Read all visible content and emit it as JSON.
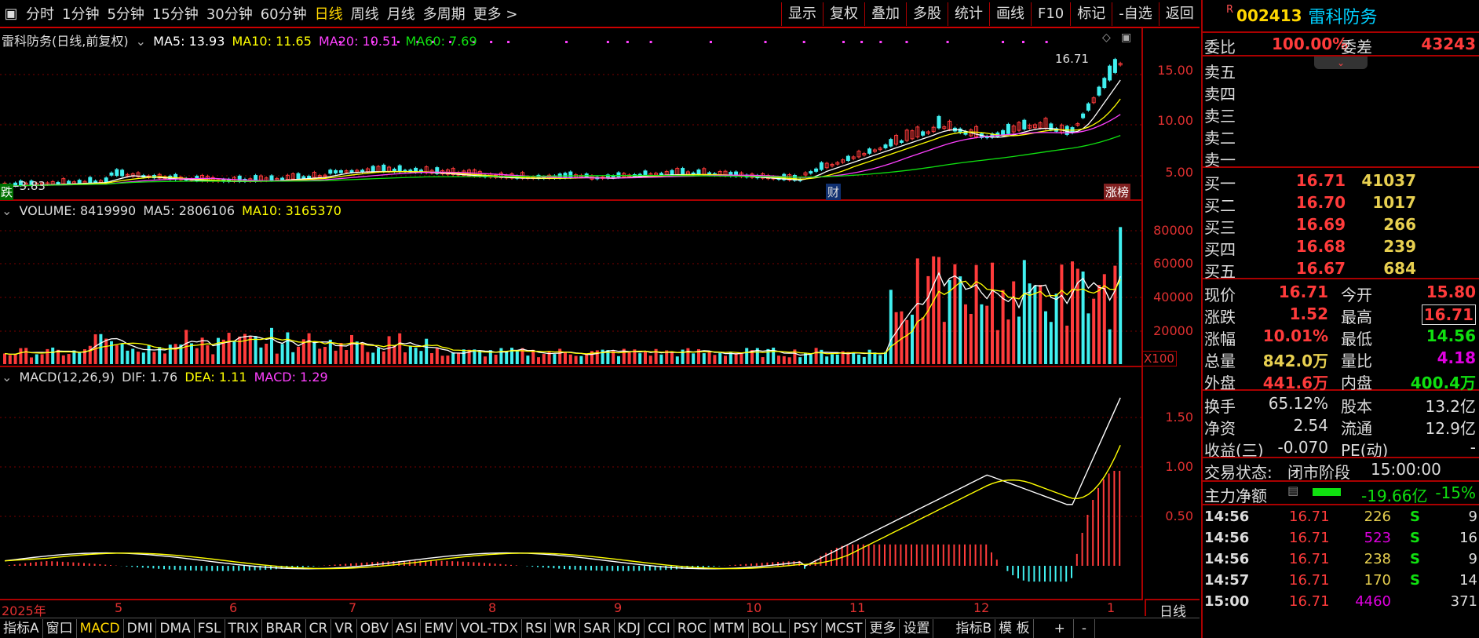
{
  "period_bar": {
    "items": [
      "分时",
      "1分钟",
      "5分钟",
      "15分钟",
      "30分钟",
      "60分钟",
      "日线",
      "周线",
      "月线",
      "多周期",
      "更多 >"
    ],
    "active_index": 6
  },
  "tool_bar": [
    "显示",
    "复权",
    "叠加",
    "多股",
    "统计",
    "画线",
    "F10",
    "标记",
    "-自选",
    "返回"
  ],
  "kline": {
    "title": "雷科防务(日线,前复权)",
    "ma5": "MA5: 13.93",
    "ma10": "MA10: 11.65",
    "ma20": "MA20: 10.51",
    "ma60": "MA60: 7.69",
    "high_marker": "16.71",
    "low_marker": "3.83",
    "y_ticks": [
      "15.00",
      "10.00",
      "5.00"
    ],
    "tag_fall": "跌",
    "tag_cai": "财",
    "tag_zhangbang": "涨榜"
  },
  "volume": {
    "title": "VOLUME: 8419990",
    "ma5": "MA5: 2806106",
    "ma10": "MA10: 3165370",
    "y_ticks": [
      "80000",
      "60000",
      "40000",
      "20000"
    ],
    "unit": "X100"
  },
  "macd": {
    "title": "MACD(12,26,9)",
    "dif": "DIF: 1.76",
    "dea": "DEA: 1.11",
    "macd": "MACD: 1.29",
    "y_ticks": [
      "1.50",
      "1.00",
      "0.50"
    ]
  },
  "date_axis": [
    "2025年",
    "5",
    "6",
    "7",
    "8",
    "9",
    "10",
    "11",
    "12",
    "1"
  ],
  "period_label": "日线",
  "indicator_tabs": [
    "指标A",
    "窗口",
    "MACD",
    "DMI",
    "DMA",
    "FSL",
    "TRIX",
    "BRAR",
    "CR",
    "VR",
    "OBV",
    "ASI",
    "EMV",
    "VOL-TDX",
    "RSI",
    "WR",
    "SAR",
    "KDJ",
    "CCI",
    "ROC",
    "MTM",
    "BOLL",
    "PSY",
    "MCST",
    "更多",
    "设置",
    "指标B",
    "模 板",
    "+",
    "-"
  ],
  "active_indicator": "MACD",
  "quote": {
    "r_mark": "R",
    "code": "002413",
    "name": "雷科防务",
    "weibi_label": "委比",
    "weibi": "100.00%",
    "weicha_label": "委差",
    "weicha": "43243",
    "sell": [
      {
        "label": "卖五",
        "price": "",
        "vol": ""
      },
      {
        "label": "卖四",
        "price": "",
        "vol": ""
      },
      {
        "label": "卖三",
        "price": "",
        "vol": ""
      },
      {
        "label": "卖二",
        "price": "",
        "vol": ""
      },
      {
        "label": "卖一",
        "price": "",
        "vol": ""
      }
    ],
    "buy": [
      {
        "label": "买一",
        "price": "16.71",
        "vol": "41037"
      },
      {
        "label": "买二",
        "price": "16.70",
        "vol": "1017"
      },
      {
        "label": "买三",
        "price": "16.69",
        "vol": "266"
      },
      {
        "label": "买四",
        "price": "16.68",
        "vol": "239"
      },
      {
        "label": "买五",
        "price": "16.67",
        "vol": "684"
      }
    ],
    "stats": [
      {
        "l1": "现价",
        "v1": "16.71",
        "c1": "red",
        "l2": "今开",
        "v2": "15.80",
        "c2": "red"
      },
      {
        "l1": "涨跌",
        "v1": "1.52",
        "c1": "red",
        "l2": "最高",
        "v2": "16.71",
        "c2": "red"
      },
      {
        "l1": "涨幅",
        "v1": "10.01%",
        "c1": "red",
        "l2": "最低",
        "v2": "14.56",
        "c2": "green"
      },
      {
        "l1": "总量",
        "v1": "842.0万",
        "c1": "yellow",
        "l2": "量比",
        "v2": "4.18",
        "c2": "purple"
      },
      {
        "l1": "外盘",
        "v1": "441.6万",
        "c1": "red",
        "l2": "内盘",
        "v2": "400.4万",
        "c2": "green"
      }
    ],
    "stats2": [
      {
        "l1": "换手",
        "v1": "65.12%",
        "l2": "股本",
        "v2": "13.2亿"
      },
      {
        "l1": "净资",
        "v1": "2.54",
        "l2": "流通",
        "v2": "12.9亿"
      },
      {
        "l1": "收益(三)",
        "v1": "-0.070",
        "l2": "PE(动)",
        "v2": "-"
      }
    ],
    "status_label": "交易状态:",
    "status": "闭市阶段",
    "status_time": "15:00:00",
    "net_label": "主力净额",
    "net_value": "-19.66亿",
    "net_pct": "-15%",
    "ticks": [
      {
        "time": "14:56",
        "price": "16.71",
        "vol": "226",
        "vc": "yellow",
        "side": "S",
        "n": "9"
      },
      {
        "time": "14:56",
        "price": "16.71",
        "vol": "523",
        "vc": "purple",
        "side": "S",
        "n": "16"
      },
      {
        "time": "14:56",
        "price": "16.71",
        "vol": "238",
        "vc": "yellow",
        "side": "S",
        "n": "9"
      },
      {
        "time": "14:57",
        "price": "16.71",
        "vol": "170",
        "vc": "yellow",
        "side": "S",
        "n": "14"
      },
      {
        "time": "15:00",
        "price": "16.71",
        "vol": "4460",
        "vc": "purple",
        "side": "",
        "n": "371"
      }
    ]
  },
  "colors": {
    "up": "#ff3b3b",
    "down": "#40f0f0",
    "ma5": "#ffffff",
    "ma10": "#ffff00",
    "ma20": "#ff40ff",
    "ma60": "#10e010",
    "grid": "#7a0000"
  }
}
